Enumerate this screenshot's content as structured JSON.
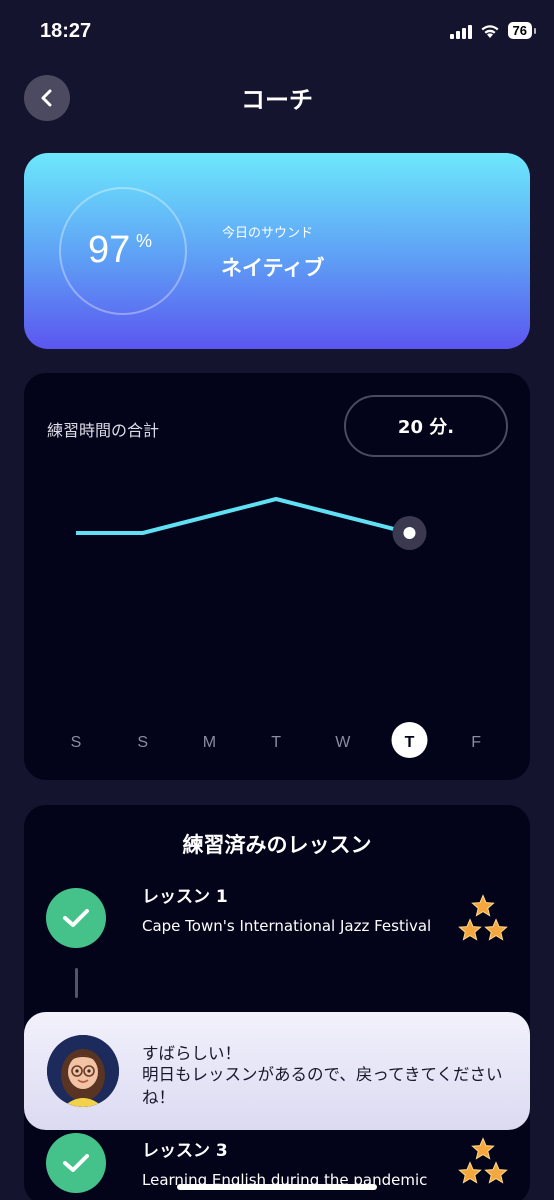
{
  "status_bar": {
    "time": "18:27",
    "battery": "76"
  },
  "header": {
    "title": "コーチ"
  },
  "score": {
    "value": "97",
    "unit": "%",
    "label": "今日のサウンド",
    "level": "ネイティブ"
  },
  "practice": {
    "title": "練習時間の合計",
    "total": "20 分."
  },
  "chart_data": {
    "type": "line",
    "categories": [
      "S",
      "S",
      "M",
      "T",
      "W",
      "T",
      "F"
    ],
    "values": [
      0.5,
      0.5,
      0.75,
      1.0,
      0.75,
      0.5,
      null
    ],
    "selected_index": 5,
    "title": "",
    "xlabel": "",
    "ylabel": "",
    "grid": false,
    "accent_color": "#5fe0f3"
  },
  "lessons": {
    "title": "練習済みのレッスン",
    "items": [
      {
        "name": "レッスン 1",
        "description": "Cape Town's International Jazz Festival",
        "stars": 3
      },
      {
        "name": "レッスン 3",
        "description": "Learning English during the pandemic",
        "stars": 3
      }
    ]
  },
  "toast": {
    "line1": "すばらしい！",
    "line2": "明日もレッスンがあるので、戻ってきてくださいね！"
  },
  "colors": {
    "background": "#15142f",
    "card": "#03031a",
    "check": "#44c28a",
    "star": "#f4a63f"
  }
}
